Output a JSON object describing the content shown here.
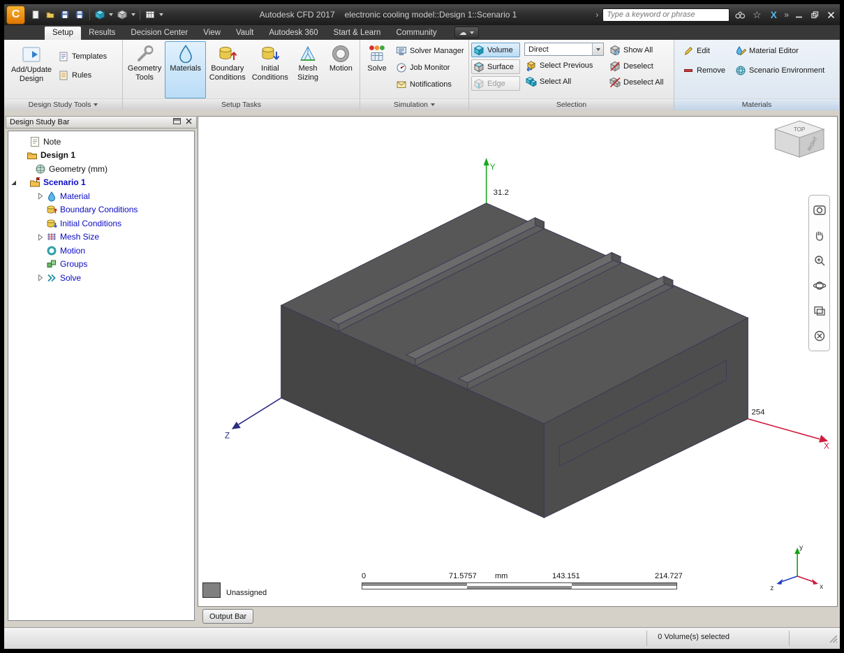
{
  "icons": {
    "logo": "C",
    "nav_expand": "›",
    "star": "☆",
    "exchange": "X",
    "overflow": "»",
    "cloud": "☁"
  },
  "titlebar": {
    "app_title": "Autodesk CFD 2017",
    "doc_title": "electronic cooling model::Design 1::Scenario 1",
    "search_placeholder": "Type a keyword or phrase"
  },
  "menubar": {
    "tabs": [
      {
        "label": "Setup"
      },
      {
        "label": "Results"
      },
      {
        "label": "Decision Center"
      },
      {
        "label": "View"
      },
      {
        "label": "Vault"
      },
      {
        "label": "Autodesk 360"
      },
      {
        "label": "Start & Learn"
      },
      {
        "label": "Community"
      }
    ],
    "active_tab": "Setup"
  },
  "ribbon": {
    "design_study_tools": {
      "label": "Design Study Tools",
      "add_update_design": "Add/Update Design",
      "templates": "Templates",
      "rules": "Rules"
    },
    "setup_tasks": {
      "label": "Setup Tasks",
      "geometry_tools": "Geometry Tools",
      "materials": "Materials",
      "boundary_conditions": "Boundary Conditions",
      "initial_conditions": "Initial Conditions",
      "mesh_sizing": "Mesh Sizing",
      "motion": "Motion"
    },
    "simulation": {
      "label": "Simulation",
      "solve": "Solve",
      "solver_manager": "Solver Manager",
      "job_monitor": "Job Monitor",
      "notifications": "Notifications"
    },
    "selection": {
      "label": "Selection",
      "volume": "Volume",
      "surface": "Surface",
      "edge": "Edge",
      "filter_value": "Direct",
      "select_previous": "Select Previous",
      "select_all": "Select All",
      "show_all": "Show All",
      "deselect": "Deselect",
      "deselect_all": "Deselect All"
    },
    "materials": {
      "label": "Materials",
      "edit": "Edit",
      "remove": "Remove",
      "material_editor": "Material Editor",
      "scenario_environment": "Scenario Environment"
    }
  },
  "design_study_bar": {
    "title": "Design Study Bar",
    "tree": [
      {
        "label": "Note"
      },
      {
        "label": "Design 1"
      },
      {
        "label": "Geometry (mm)"
      },
      {
        "label": "Scenario 1"
      },
      {
        "label": "Material"
      },
      {
        "label": "Boundary Conditions"
      },
      {
        "label": "Initial Conditions"
      },
      {
        "label": "Mesh Size"
      },
      {
        "label": "Motion"
      },
      {
        "label": "Groups"
      },
      {
        "label": "Solve"
      }
    ]
  },
  "viewport": {
    "y_dim": "31.2",
    "x_dim": "254",
    "axis": {
      "x": "X",
      "y": "Y",
      "z": "Z"
    },
    "triad": {
      "x": "x",
      "y": "y",
      "z": "z"
    },
    "viewcube": {
      "top": "TOP",
      "right": "RIGHT"
    },
    "scale_bar": {
      "ticks": [
        "0",
        "71.5757",
        "143.151",
        "214.727"
      ],
      "unit": "mm"
    },
    "legend": {
      "label": "Unassigned",
      "swatch_color": "#808080"
    },
    "model_color": "#575757"
  },
  "output_bar_label": "Output Bar",
  "status_bar": {
    "selection_status": "0 Volume(s) selected"
  }
}
